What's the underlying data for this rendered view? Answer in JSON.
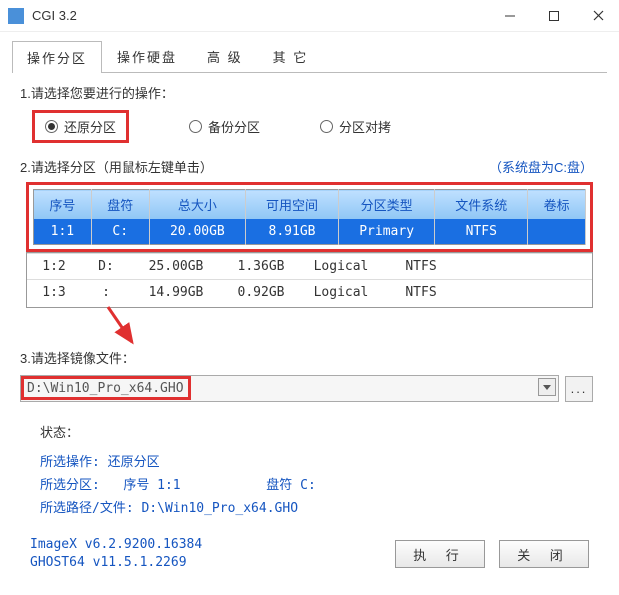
{
  "window": {
    "title": "CGI 3.2"
  },
  "tabs": {
    "items": [
      {
        "label": "操作分区",
        "active": true
      },
      {
        "label": "操作硬盘",
        "active": false
      },
      {
        "label": "高 级",
        "active": false
      },
      {
        "label": "其 它",
        "active": false
      }
    ]
  },
  "section1": {
    "title": "1.请选择您要进行的操作：",
    "options": [
      {
        "label": "还原分区",
        "selected": true
      },
      {
        "label": "备份分区",
        "selected": false
      },
      {
        "label": "分区对拷",
        "selected": false
      }
    ]
  },
  "section2": {
    "title": "2.请选择分区（用鼠标左键单击）",
    "sysdisk": "（系统盘为C:盘）",
    "headers": [
      "序号",
      "盘符",
      "总大小",
      "可用空间",
      "分区类型",
      "文件系统",
      "卷标"
    ],
    "rows": [
      {
        "idx": "1:1",
        "drive": "C:",
        "total": "20.00GB",
        "free": "8.91GB",
        "ptype": "Primary",
        "fs": "NTFS",
        "label": "",
        "selected": true
      },
      {
        "idx": "1:2",
        "drive": "D:",
        "total": "25.00GB",
        "free": "1.36GB",
        "ptype": "Logical",
        "fs": "NTFS",
        "label": "",
        "selected": false
      },
      {
        "idx": "1:3",
        "drive": ":",
        "total": "14.99GB",
        "free": "0.92GB",
        "ptype": "Logical",
        "fs": "NTFS",
        "label": "",
        "selected": false
      }
    ]
  },
  "section3": {
    "title": "3.请选择镜像文件：",
    "path": "D:\\Win10_Pro_x64.GHO",
    "browse": "..."
  },
  "status": {
    "heading": "状态：",
    "op_label": "所选操作:",
    "op_value": "还原分区",
    "part_label": "所选分区:",
    "part_idx_label": "序号",
    "part_idx": "1:1",
    "drive_label": "盘符",
    "drive": "C:",
    "path_label": "所选路径/文件:",
    "path": "D:\\Win10_Pro_x64.GHO"
  },
  "versions": {
    "imagex": "ImageX v6.2.9200.16384",
    "ghost": "GHOST64 v11.5.1.2269"
  },
  "buttons": {
    "execute": "执 行",
    "close": "关 闭"
  }
}
